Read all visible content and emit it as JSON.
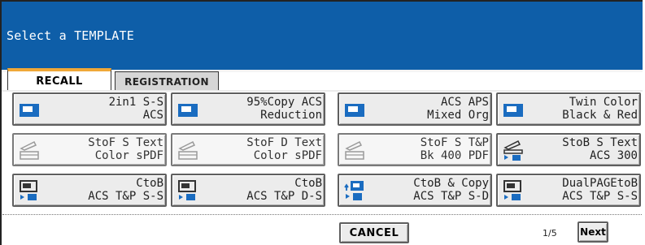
{
  "header": {
    "title": "Select a TEMPLATE"
  },
  "tabs": [
    {
      "label": "RECALL",
      "active": true
    },
    {
      "label": "REGISTRATION",
      "active": false
    }
  ],
  "templates": [
    {
      "line1": "2in1 S-S",
      "line2": "ACS",
      "icon": "copy-icon",
      "enabled": true
    },
    {
      "line1": "95%Copy ACS",
      "line2": "Reduction",
      "icon": "copy-icon",
      "enabled": true
    },
    {
      "line1": "ACS APS",
      "line2": "Mixed Org",
      "icon": "copy-icon",
      "enabled": true
    },
    {
      "line1": "Twin Color",
      "line2": "Black & Red",
      "icon": "copy-icon",
      "enabled": true
    },
    {
      "line1": "StoF S Text",
      "line2": "Color sPDF",
      "icon": "scan-to-file-icon",
      "enabled": false
    },
    {
      "line1": "StoF D Text",
      "line2": "Color sPDF",
      "icon": "scan-to-file-icon",
      "enabled": false
    },
    {
      "line1": "StoF S T&P",
      "line2": "Bk 400 PDF",
      "icon": "scan-to-file-icon",
      "enabled": false
    },
    {
      "line1": "StoB S Text",
      "line2": "ACS 300",
      "icon": "scan-to-box-icon",
      "enabled": true
    },
    {
      "line1": "CtoB",
      "line2": "ACS T&P S-S",
      "icon": "copy-to-box-icon",
      "enabled": true
    },
    {
      "line1": "CtoB",
      "line2": "ACS T&P D-S",
      "icon": "copy-to-box-icon",
      "enabled": true
    },
    {
      "line1": "CtoB & Copy",
      "line2": "ACS T&P S-D",
      "icon": "copy-and-box-icon",
      "enabled": true
    },
    {
      "line1": "DualPAGEtoB",
      "line2": "ACS T&P S-S",
      "icon": "copy-to-box-icon",
      "enabled": true
    }
  ],
  "footer": {
    "cancel_label": "CANCEL",
    "page_indicator": "1/5",
    "next_label": "Next"
  },
  "colors": {
    "title_bar": "#0e5ea8",
    "active_tab_accent": "#f0a838",
    "button_face": "#ececec",
    "icon_blue": "#1a6cc0"
  }
}
